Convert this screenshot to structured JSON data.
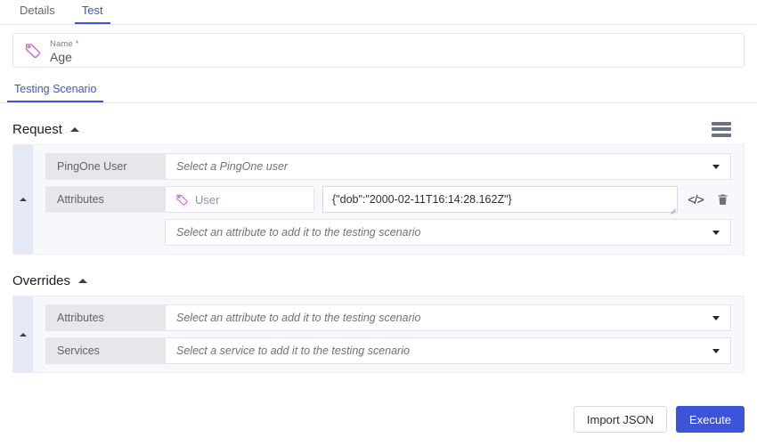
{
  "tabs": [
    {
      "label": "Details",
      "active": false
    },
    {
      "label": "Test",
      "active": true
    }
  ],
  "name_field": {
    "label": "Name",
    "required_marker": "*",
    "value": "Age",
    "icon": "tag-icon"
  },
  "subtabs": [
    {
      "label": "Testing Scenario",
      "active": true
    }
  ],
  "request_section": {
    "title": "Request",
    "collapse_icon": "caret-up-icon",
    "menu_icon": "hamburger-menu-icon",
    "rows": {
      "pingone_user": {
        "label": "PingOne User",
        "placeholder": "Select a PingOne user"
      },
      "attributes": {
        "label": "Attributes",
        "chip_label": "User",
        "chip_icon": "tag-icon",
        "json_value": "{\"dob\":\"2000-02-11T16:14:28.162Z\"}",
        "code_icon": "</>",
        "delete_icon": "trash-icon"
      },
      "add_attribute": {
        "placeholder": "Select an attribute to add it to the testing scenario"
      }
    }
  },
  "overrides_section": {
    "title": "Overrides",
    "collapse_icon": "caret-up-icon",
    "rows": {
      "attributes": {
        "label": "Attributes",
        "placeholder": "Select an attribute to add it to the testing scenario"
      },
      "services": {
        "label": "Services",
        "placeholder": "Select a service to add it to the testing scenario"
      }
    }
  },
  "footer": {
    "import_label": "Import JSON",
    "execute_label": "Execute"
  },
  "colors": {
    "accent": "#3d53d8",
    "tag": "#cf5fe0",
    "chip_text": "#8f93a8",
    "panel_bg": "#f7f8fc",
    "strip_bg": "#e4e8f7",
    "row_label_bg": "#e6e7ea"
  }
}
